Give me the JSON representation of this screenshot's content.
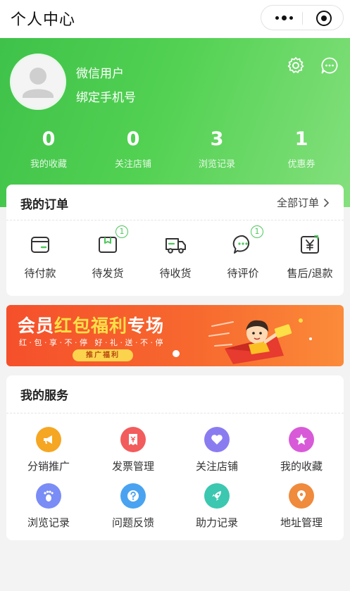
{
  "topbar": {
    "title": "个人中心",
    "more_icon": "more-dots-icon",
    "close_icon": "target-close-icon"
  },
  "profile": {
    "name": "微信用户",
    "bind_phone": "绑定手机号",
    "settings_icon": "gear-icon",
    "message_icon": "chat-bubble-icon"
  },
  "stats": [
    {
      "value": "0",
      "label": "我的收藏"
    },
    {
      "value": "0",
      "label": "关注店铺"
    },
    {
      "value": "3",
      "label": "浏览记录"
    },
    {
      "value": "1",
      "label": "优惠券"
    }
  ],
  "orders": {
    "title": "我的订单",
    "all_link": "全部订单",
    "items": [
      {
        "label": "待付款",
        "icon": "wallet-icon",
        "badge": ""
      },
      {
        "label": "待发货",
        "icon": "package-icon",
        "badge": "1"
      },
      {
        "label": "待收货",
        "icon": "truck-icon",
        "badge": ""
      },
      {
        "label": "待评价",
        "icon": "comment-icon",
        "badge": "1"
      },
      {
        "label": "售后/退款",
        "icon": "refund-icon",
        "badge": ""
      }
    ]
  },
  "banner": {
    "title_a": "会员",
    "title_b": "红包福利",
    "title_c": "专场",
    "subtitle": "红·包·享·不·停 好·礼·送·不·停",
    "button": "推广福利"
  },
  "services": {
    "title": "我的服务",
    "items": [
      {
        "label": "分销推广",
        "icon": "megaphone-icon",
        "color": "#f5a623"
      },
      {
        "label": "发票管理",
        "icon": "invoice-icon",
        "color": "#f25c5c"
      },
      {
        "label": "关注店铺",
        "icon": "heart-icon",
        "color": "#8a7cf0"
      },
      {
        "label": "我的收藏",
        "icon": "star-icon",
        "color": "#d85ad8"
      },
      {
        "label": "浏览记录",
        "icon": "footprint-icon",
        "color": "#7a8cf5"
      },
      {
        "label": "问题反馈",
        "icon": "question-icon",
        "color": "#4aa3f0"
      },
      {
        "label": "助力记录",
        "icon": "rocket-icon",
        "color": "#3cc7b0"
      },
      {
        "label": "地址管理",
        "icon": "location-pin-icon",
        "color": "#f08a3c"
      }
    ]
  }
}
